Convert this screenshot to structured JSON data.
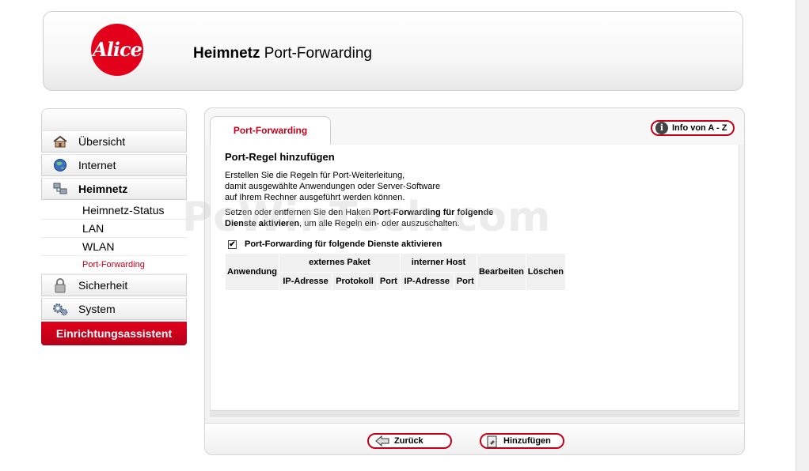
{
  "header": {
    "logo_text": "Alice",
    "title_bold": "Heimnetz",
    "title_rest": "Port-Forwarding"
  },
  "sidebar": {
    "items": [
      {
        "label": "Übersicht",
        "icon": "home-icon"
      },
      {
        "label": "Internet",
        "icon": "globe-icon"
      },
      {
        "label": "Heimnetz",
        "icon": "network-icon"
      }
    ],
    "subitems": [
      "Heimnetz-Status",
      "LAN",
      "WLAN",
      "Port-Forwarding"
    ],
    "items_after": [
      {
        "label": "Sicherheit",
        "icon": "lock-icon"
      },
      {
        "label": "System",
        "icon": "gears-icon"
      }
    ],
    "wizard_label": "Einrichtungsassistent"
  },
  "tabs": {
    "active": "Port-Forwarding"
  },
  "info_button": "Info von A - Z",
  "main": {
    "heading": "Port-Regel hinzufügen",
    "desc_lines": [
      "Erstellen Sie die Regeln für Port-Weiterleitung,",
      "damit ausgewählte Anwendungen oder Server-Software",
      "auf Ihrem Rechner ausgeführt werden können."
    ],
    "desc2_a": "Setzen oder entfernen Sie den Haken ",
    "desc2_b": "Port-Forwarding für folgende",
    "desc2_c": "Dienste aktivieren",
    "desc2_d": ", um alle Regeln ein- oder auszuschalten.",
    "checkbox_label": "Port-Forwarding für folgende Dienste aktivieren",
    "checkbox_checked": true
  },
  "table": {
    "anwendung": "Anwendung",
    "externes": "externes Paket",
    "interner": "interner Host",
    "bearbeiten": "Bearbeiten",
    "loeschen": "Löschen",
    "ip1": "IP-Adresse",
    "protokoll": "Protokoll",
    "port1": "Port",
    "ip2": "IP-Adresse",
    "port2": "Port"
  },
  "buttons": {
    "back": "Zurück",
    "add": "Hinzufügen"
  },
  "watermark": "PcWinTech.com",
  "colors": {
    "accent": "#c4001a",
    "brand_red": "#e2001a"
  }
}
